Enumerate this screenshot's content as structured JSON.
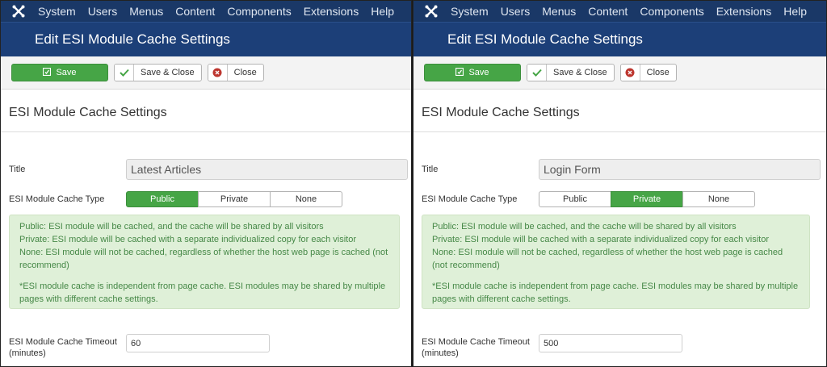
{
  "menu": [
    "System",
    "Users",
    "Menus",
    "Content",
    "Components",
    "Extensions",
    "Help"
  ],
  "icons": {
    "brand": "joomla-icon",
    "save": "save-icon",
    "save_close": "check-icon",
    "close": "close-icon"
  },
  "colors": {
    "menubar": "#1a3867",
    "titlebar": "#1c3f78",
    "success": "#46a546",
    "info_bg": "#dff0d8",
    "info_text": "#468847"
  },
  "panels": [
    {
      "page_title": "Edit ESI Module Cache Settings",
      "toolbar": {
        "save": "Save",
        "save_close": "Save & Close",
        "close": "Close"
      },
      "section_title": "ESI Module Cache Settings",
      "fields": {
        "title_label": "Title",
        "title_value": "Latest Articles",
        "type_label": "ESI Module Cache Type",
        "type_options": [
          "Public",
          "Private",
          "None"
        ],
        "type_selected": "Public",
        "timeout_label_1": "ESI Module Cache Timeout",
        "timeout_label_2": "(minutes)",
        "timeout_value": "60"
      },
      "info": [
        "Public: ESI module will be cached, and the cache will be shared by all visitors",
        "Private: ESI module will be cached with a separate individualized copy for each visitor",
        "None: ESI module will not be cached, regardless of whether the host web page is cached (not recommend)",
        "",
        "*ESI module cache is independent from page cache. ESI modules may be shared by multiple pages with different cache settings."
      ]
    },
    {
      "page_title": "Edit ESI Module Cache Settings",
      "toolbar": {
        "save": "Save",
        "save_close": "Save & Close",
        "close": "Close"
      },
      "section_title": "ESI Module Cache Settings",
      "fields": {
        "title_label": "Title",
        "title_value": "Login Form",
        "type_label": "ESI Module Cache Type",
        "type_options": [
          "Public",
          "Private",
          "None"
        ],
        "type_selected": "Private",
        "timeout_label_1": "ESI Module Cache Timeout",
        "timeout_label_2": "(minutes)",
        "timeout_value": "500"
      },
      "info": [
        "Public: ESI module will be cached, and the cache will be shared by all visitors",
        "Private: ESI module will be cached with a separate individualized copy for each visitor",
        "None: ESI module will not be cached, regardless of whether the host web page is cached (not recommend)",
        "",
        "*ESI module cache is independent from page cache. ESI modules may be shared by multiple pages with different cache settings."
      ]
    }
  ]
}
